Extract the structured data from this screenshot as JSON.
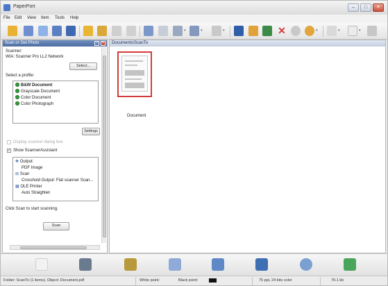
{
  "window": {
    "title": "PaperPort",
    "minimize": "–",
    "maximize": "□",
    "close": "✕"
  },
  "menu": [
    "File",
    "Edit",
    "View",
    "Item",
    "Tools",
    "Help"
  ],
  "left_pane": {
    "title": "Scan or Get Photo",
    "scanner_label": "Scanner:",
    "scanner_name": "WIA: Scanner Pro LL2 Network",
    "select_button": "Select...",
    "profile_label": "Select a profile:",
    "profiles": [
      "B&W Document",
      "Grayscale Document",
      "Color Document",
      "Color Photograph"
    ],
    "settings_button": "Settings",
    "display_dialog_label": "Display scanner dialog box",
    "show_assistant_label": "Show ScannerAssistant",
    "workflow": [
      "Output:",
      "PDF Image",
      "Scan",
      "Crosshold Output: Flat scanner Scan...",
      "OLE Printer",
      "Auto Straighten"
    ],
    "hint": "Click Scan to start scanning.",
    "scan_button": "Scan"
  },
  "main_pane": {
    "path": "Documents\\ScanTo",
    "items": [
      {
        "label": "Document",
        "selected": true
      }
    ]
  },
  "status": {
    "folder": "Folder: ScanTo (1 items), Object: Document.pdf",
    "white_point": "White point:",
    "black_point": "Black point:",
    "resolution": "75 ppi, 24 bits color",
    "size": "79.1 kb"
  },
  "icons": {
    "toolbar": [
      "new-doc-icon",
      "scan-icon",
      "copy-icon",
      "print-icon",
      "folder-open-icon",
      "folder-icon",
      "cut-icon",
      "paste-icon",
      "view-page-icon",
      "view-thumbnails-icon",
      "view-list-icon",
      "filter-icon",
      "sort-icon",
      "save-icon",
      "rotate-icon",
      "mail-icon",
      "delete-icon",
      "search-icon",
      "help-icon",
      "stack-icon",
      "page-icon",
      "options-icon"
    ],
    "send_to": [
      "send-blank-icon",
      "printer-icon",
      "tools-icon",
      "document-edit-icon",
      "image-editor-icon",
      "outlook-icon",
      "palette-icon",
      "pdf-create-icon"
    ]
  },
  "colors": {
    "pane_header": "#5a7bb5",
    "accent_green": "#2f9e37",
    "selection_red": "#d43a3a"
  }
}
